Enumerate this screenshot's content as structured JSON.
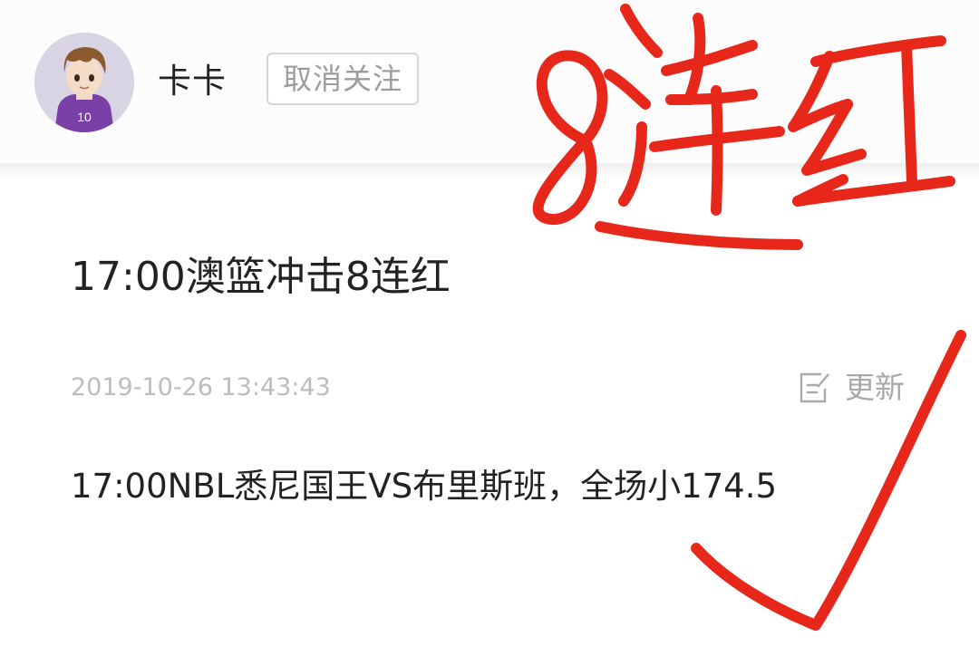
{
  "header": {
    "username": "卡卡",
    "unfollow_label": "取消关注",
    "avatar_number": "10"
  },
  "post": {
    "title": "17:00澳篮冲击8连红",
    "timestamp": "2019-10-26 13:43:43",
    "update_label": "更新",
    "body": "17:00NBL悉尼国王VS布里斯班，全场小174.5"
  },
  "overlay": {
    "handwritten_text": "8连红",
    "ink_color": "#e8271b"
  },
  "icons": {
    "edit": "edit-icon",
    "checkmark": "checkmark-annotation"
  }
}
